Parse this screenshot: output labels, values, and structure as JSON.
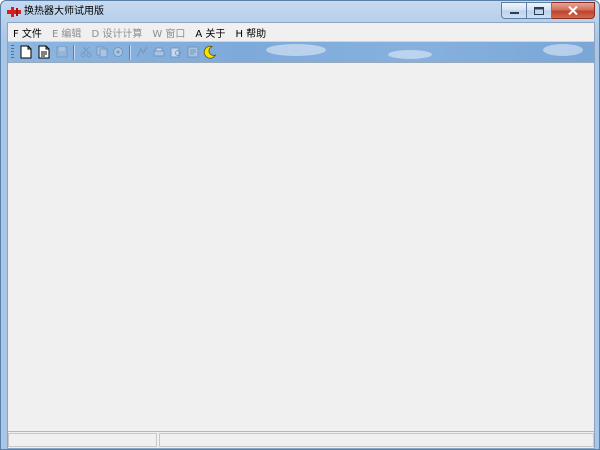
{
  "window": {
    "title": "换热器大师试用版",
    "caption_buttons": {
      "minimize_icon": "minimize-icon",
      "maximize_icon": "maximize-icon",
      "close_icon": "close-icon"
    }
  },
  "menu": [
    {
      "label": "F 文件",
      "enabled": true
    },
    {
      "label": "E 编辑",
      "enabled": false
    },
    {
      "label": "D 设计计算",
      "enabled": false
    },
    {
      "label": "W 窗口",
      "enabled": false
    },
    {
      "label": "A 关于",
      "enabled": true
    },
    {
      "label": "H 帮助",
      "enabled": true
    }
  ],
  "toolbar": {
    "buttons": [
      {
        "icon": "new-file-icon",
        "enabled": true
      },
      {
        "icon": "open-file-icon",
        "enabled": true
      },
      {
        "icon": "save-icon",
        "enabled": false
      },
      {
        "icon": "cut-icon",
        "enabled": false
      },
      {
        "icon": "copy-icon",
        "enabled": false
      },
      {
        "icon": "paste-icon",
        "enabled": false
      },
      {
        "icon": "calculate-icon",
        "enabled": false
      },
      {
        "icon": "print-icon",
        "enabled": false
      },
      {
        "icon": "print-preview-icon",
        "enabled": false
      },
      {
        "icon": "report-icon",
        "enabled": false
      },
      {
        "icon": "moon-icon",
        "enabled": true
      }
    ]
  },
  "statusbar": {
    "panels": [
      "",
      ""
    ]
  },
  "colors": {
    "titlebar": "#b9d1ea",
    "toolbar": "#84afdc",
    "client": "#f0f0f0",
    "close_button": "#c7503a"
  }
}
